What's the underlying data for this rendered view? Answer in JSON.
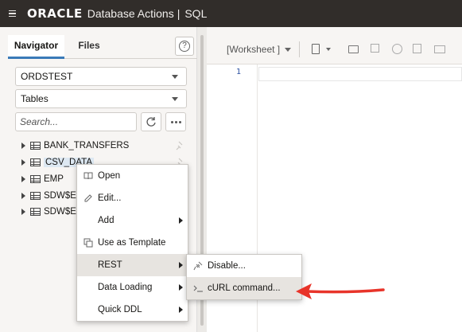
{
  "header": {
    "brand": "ORACLE",
    "product": "Database Actions",
    "separator": "|",
    "page": "SQL",
    "menu_icon": "hamburger-icon"
  },
  "navigator": {
    "tabs": [
      "Navigator",
      "Files"
    ],
    "active_tab": "Navigator",
    "help_label": "?",
    "schema_select": "ORDSTEST",
    "object_type_select": "Tables",
    "search_placeholder": "Search...",
    "tree_items": [
      "BANK_TRANSFERS",
      "CSV_DATA",
      "EMP",
      "SDW$E",
      "SDW$E"
    ]
  },
  "worksheet": {
    "title": "[Worksheet ]",
    "line_numbers": [
      "1"
    ]
  },
  "context_menu": {
    "items": [
      {
        "label": "Open",
        "icon": "book-icon"
      },
      {
        "label": "Edit...",
        "icon": "pencil-icon"
      },
      {
        "label": "Add",
        "icon": ""
      },
      {
        "label": "Use as Template",
        "icon": "copy-icon"
      },
      {
        "label": "REST",
        "icon": ""
      },
      {
        "label": "Data Loading",
        "icon": ""
      },
      {
        "label": "Quick DDL",
        "icon": ""
      }
    ],
    "highlighted": "REST"
  },
  "rest_submenu": {
    "items": [
      {
        "label": "Disable...",
        "icon": "plug-icon"
      },
      {
        "label": "cURL command...",
        "icon": "terminal-icon"
      }
    ],
    "highlighted": "cURL command..."
  },
  "colors": {
    "header_bg": "#312d2a",
    "accent": "#3a7ab8",
    "annotation_arrow": "#e8342a"
  }
}
